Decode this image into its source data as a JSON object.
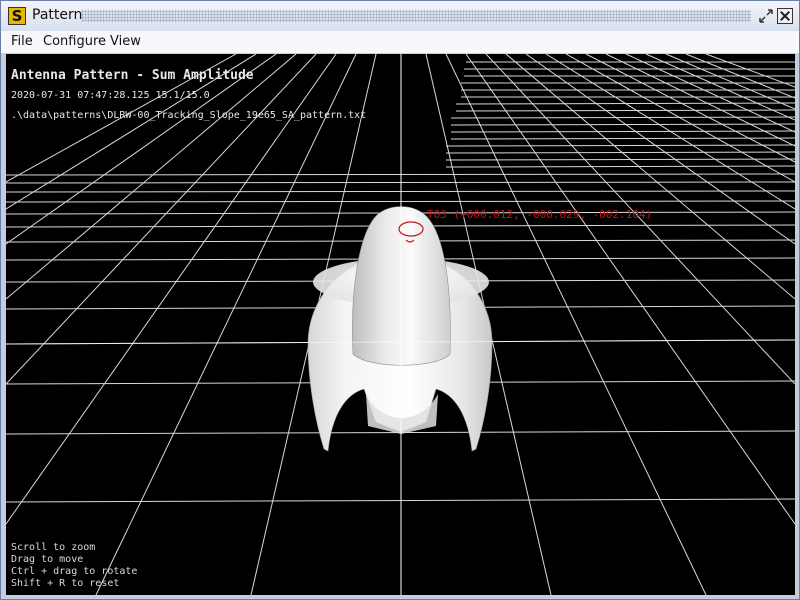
{
  "window": {
    "title": "Pattern",
    "app_icon_letter": "S"
  },
  "menu": {
    "items": [
      "File",
      "Configure",
      "View"
    ]
  },
  "overlay": {
    "title": "Antenna Pattern - Sum Amplitude",
    "timestamp": "2020-07-31 07:47:28.125 15.1/15.0",
    "file_path": ".\\data\\patterns\\DLRW-00_Tracking_Slope_19e65_SA_pattern.txt"
  },
  "marker": {
    "label": "T03 (+000.012, -000.029, -002.104)",
    "color": "#c01818"
  },
  "help": [
    "Scroll to zoom",
    "Drag to move",
    "Ctrl + drag to rotate",
    "Shift + R to reset"
  ],
  "colors": {
    "background": "#000000",
    "grid": "#ffffff",
    "surface": "#f2f2f2"
  }
}
